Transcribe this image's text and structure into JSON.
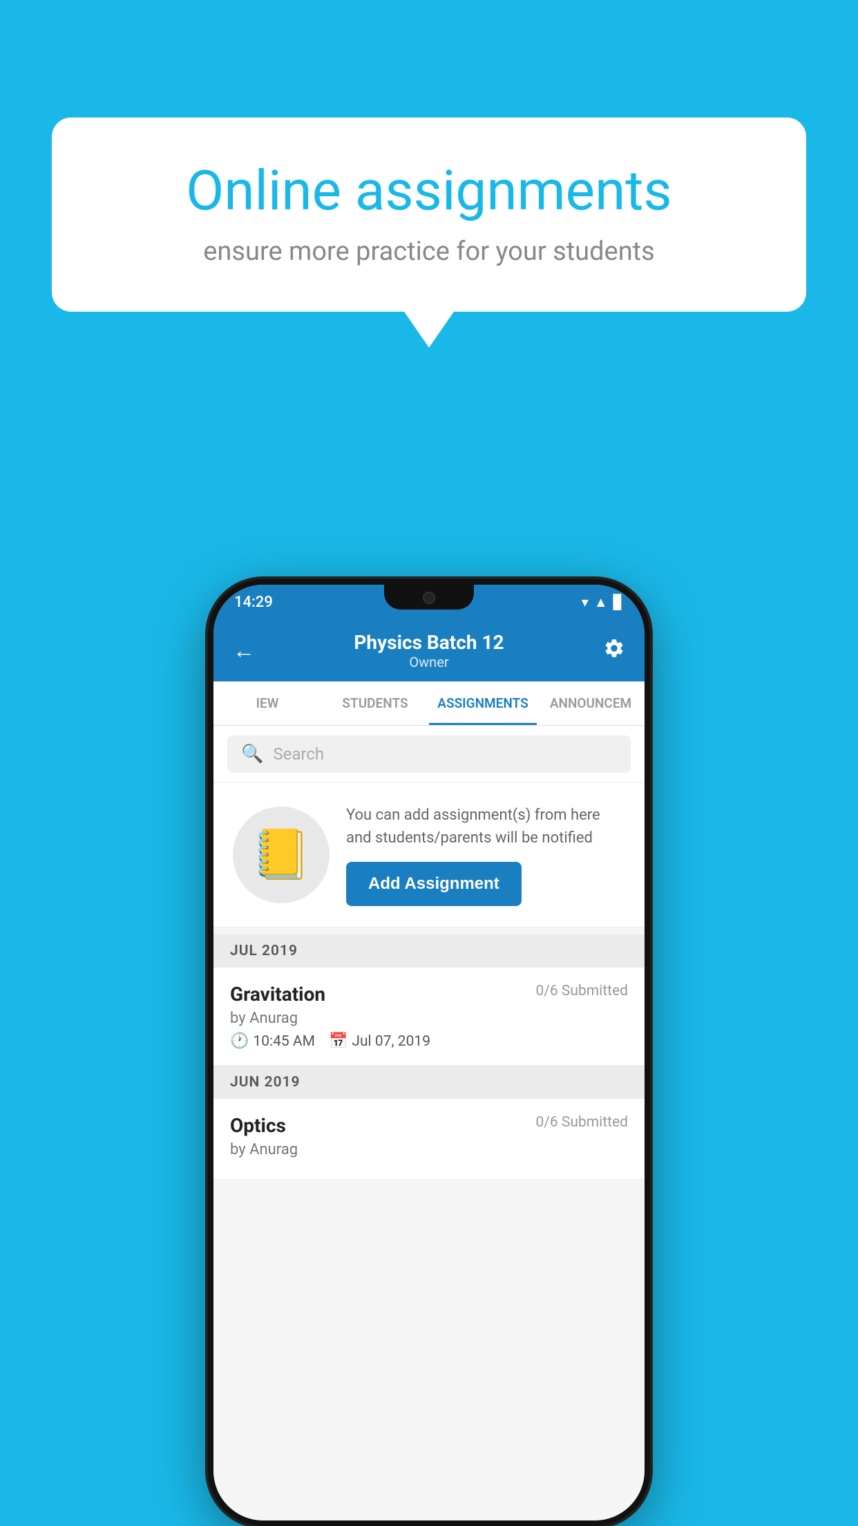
{
  "background_color": "#1ab8e8",
  "speech_bubble": {
    "title": "Online assignments",
    "subtitle": "ensure more practice for your students"
  },
  "status_bar": {
    "time": "14:29",
    "icons": [
      "▾",
      "▲",
      "▊"
    ]
  },
  "header": {
    "title": "Physics Batch 12",
    "subtitle": "Owner",
    "back_label": "←",
    "settings_label": "⚙"
  },
  "tabs": [
    {
      "label": "IEW",
      "active": false
    },
    {
      "label": "STUDENTS",
      "active": false
    },
    {
      "label": "ASSIGNMENTS",
      "active": true
    },
    {
      "label": "ANNOUNCEM",
      "active": false
    }
  ],
  "search": {
    "placeholder": "Search"
  },
  "add_assignment_card": {
    "description": "You can add assignment(s) from here and students/parents will be notified",
    "button_label": "Add Assignment"
  },
  "sections": [
    {
      "label": "JUL 2019",
      "items": [
        {
          "name": "Gravitation",
          "submitted": "0/6 Submitted",
          "author": "by Anurag",
          "time": "10:45 AM",
          "date": "Jul 07, 2019"
        }
      ]
    },
    {
      "label": "JUN 2019",
      "items": [
        {
          "name": "Optics",
          "submitted": "0/6 Submitted",
          "author": "by Anurag",
          "time": "",
          "date": ""
        }
      ]
    }
  ]
}
